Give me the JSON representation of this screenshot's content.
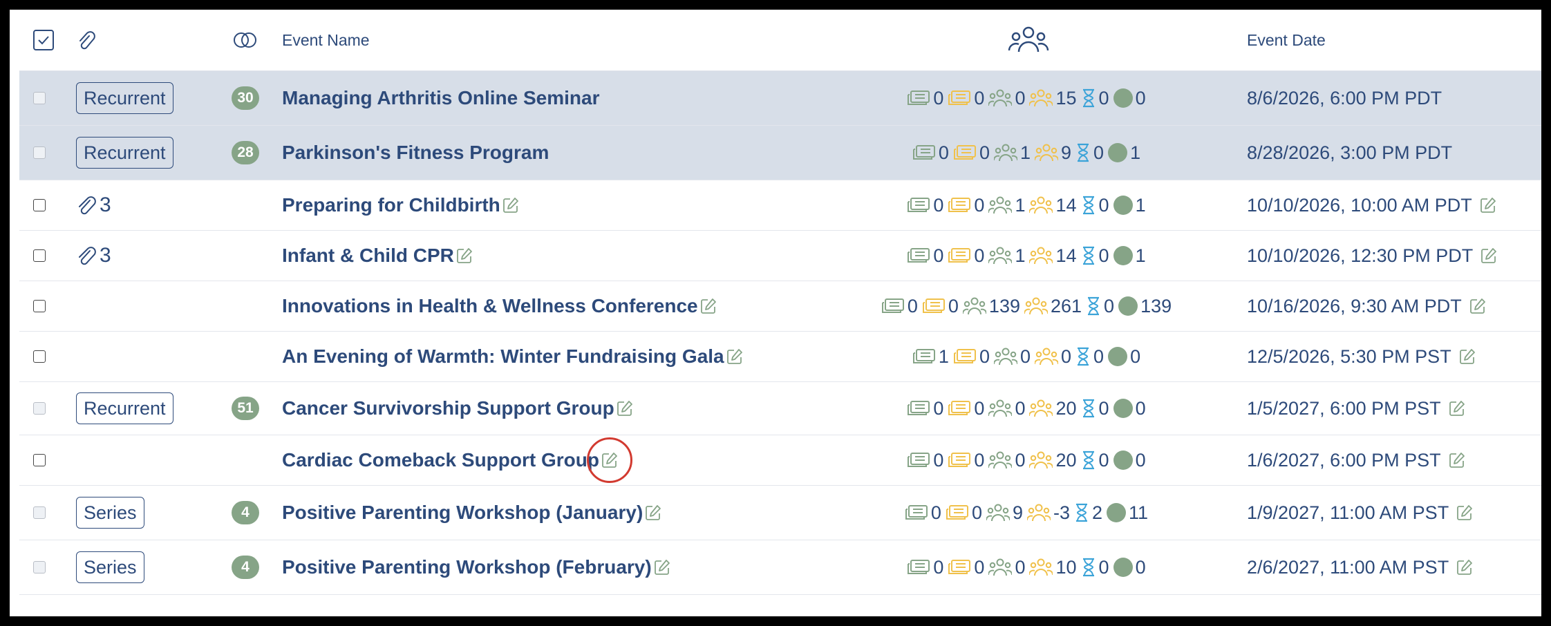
{
  "header": {
    "event_name": "Event Name",
    "event_date": "Event Date"
  },
  "colors": {
    "accent": "#2d4a7a",
    "highlight_row": "#d7dee8",
    "badge": "#86a487",
    "ticket_green": "#86a487",
    "ticket_yellow": "#f0c14b",
    "hourglass": "#3ba3d8",
    "annotation_red": "#d23a30"
  },
  "rows": [
    {
      "type": "Recurrent",
      "count": "30",
      "name": "Managing Arthritis Online Seminar",
      "editable": false,
      "attach": "",
      "a": "0",
      "b": "0",
      "c": "0",
      "d": "15",
      "e": "0",
      "f": "0",
      "date": "8/6/2026, 6:00 PM PDT",
      "highlight": true
    },
    {
      "type": "Recurrent",
      "count": "28",
      "name": "Parkinson's Fitness Program",
      "editable": false,
      "attach": "",
      "a": "0",
      "b": "0",
      "c": "1",
      "d": "9",
      "e": "0",
      "f": "1",
      "date": "8/28/2026, 3:00 PM PDT",
      "highlight": true
    },
    {
      "type": "",
      "count": "",
      "name": "Preparing for Childbirth",
      "editable": true,
      "attach": "3",
      "a": "0",
      "b": "0",
      "c": "1",
      "d": "14",
      "e": "0",
      "f": "1",
      "date": "10/10/2026, 10:00 AM PDT",
      "highlight": false
    },
    {
      "type": "",
      "count": "",
      "name": "Infant & Child CPR",
      "editable": true,
      "attach": "3",
      "a": "0",
      "b": "0",
      "c": "1",
      "d": "14",
      "e": "0",
      "f": "1",
      "date": "10/10/2026, 12:30 PM PDT",
      "highlight": false
    },
    {
      "type": "",
      "count": "",
      "name": "Innovations in Health & Wellness Conference",
      "editable": true,
      "attach": "",
      "a": "0",
      "b": "0",
      "c": "139",
      "d": "261",
      "e": "0",
      "f": "139",
      "date": "10/16/2026, 9:30 AM PDT",
      "highlight": false
    },
    {
      "type": "",
      "count": "",
      "name": "An Evening of Warmth: Winter Fundraising Gala",
      "editable": true,
      "attach": "",
      "a": "1",
      "b": "0",
      "c": "0",
      "d": "0",
      "e": "0",
      "f": "0",
      "date": "12/5/2026, 5:30 PM PST",
      "highlight": false
    },
    {
      "type": "Recurrent",
      "count": "51",
      "name": "Cancer Survivorship Support Group",
      "editable": true,
      "attach": "",
      "a": "0",
      "b": "0",
      "c": "0",
      "d": "20",
      "e": "0",
      "f": "0",
      "date": "1/5/2027, 6:00 PM PST",
      "highlight": false
    },
    {
      "type": "",
      "count": "",
      "name": "Cardiac Comeback Support Group",
      "editable": true,
      "attach": "",
      "a": "0",
      "b": "0",
      "c": "0",
      "d": "20",
      "e": "0",
      "f": "0",
      "date": "1/6/2027, 6:00 PM PST",
      "highlight": false
    },
    {
      "type": "Series",
      "count": "4",
      "name": "Positive Parenting Workshop (January)",
      "editable": true,
      "attach": "",
      "a": "0",
      "b": "0",
      "c": "9",
      "d": "-3",
      "e": "2",
      "f": "11",
      "date": "1/9/2027, 11:00 AM PST",
      "highlight": false
    },
    {
      "type": "Series",
      "count": "4",
      "name": "Positive Parenting Workshop (February)",
      "editable": true,
      "attach": "",
      "a": "0",
      "b": "0",
      "c": "0",
      "d": "10",
      "e": "0",
      "f": "0",
      "date": "2/6/2027, 11:00 AM PST",
      "highlight": false
    }
  ]
}
